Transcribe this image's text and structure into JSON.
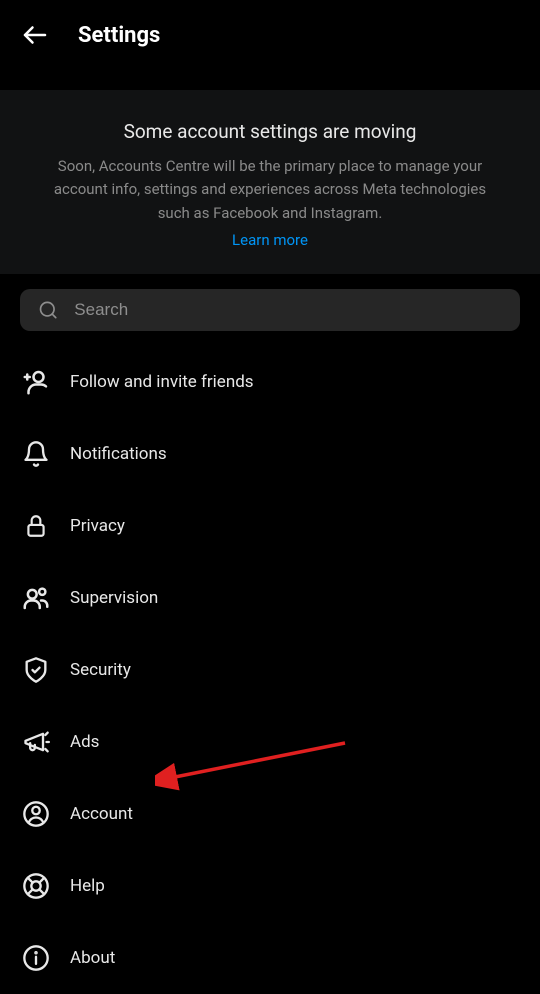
{
  "header": {
    "title": "Settings"
  },
  "banner": {
    "title": "Some account settings are moving",
    "description": "Soon, Accounts Centre will be the primary place to manage your account info, settings and experiences across Meta technologies such as Facebook and Instagram.",
    "link_text": "Learn more"
  },
  "search": {
    "placeholder": "Search"
  },
  "menu": {
    "items": [
      {
        "icon": "follow-invite-icon",
        "label": "Follow and invite friends"
      },
      {
        "icon": "bell-icon",
        "label": "Notifications"
      },
      {
        "icon": "lock-icon",
        "label": "Privacy"
      },
      {
        "icon": "supervision-icon",
        "label": "Supervision"
      },
      {
        "icon": "shield-check-icon",
        "label": "Security"
      },
      {
        "icon": "megaphone-icon",
        "label": "Ads"
      },
      {
        "icon": "account-circle-icon",
        "label": "Account"
      },
      {
        "icon": "lifebuoy-icon",
        "label": "Help"
      },
      {
        "icon": "info-icon",
        "label": "About"
      }
    ]
  }
}
